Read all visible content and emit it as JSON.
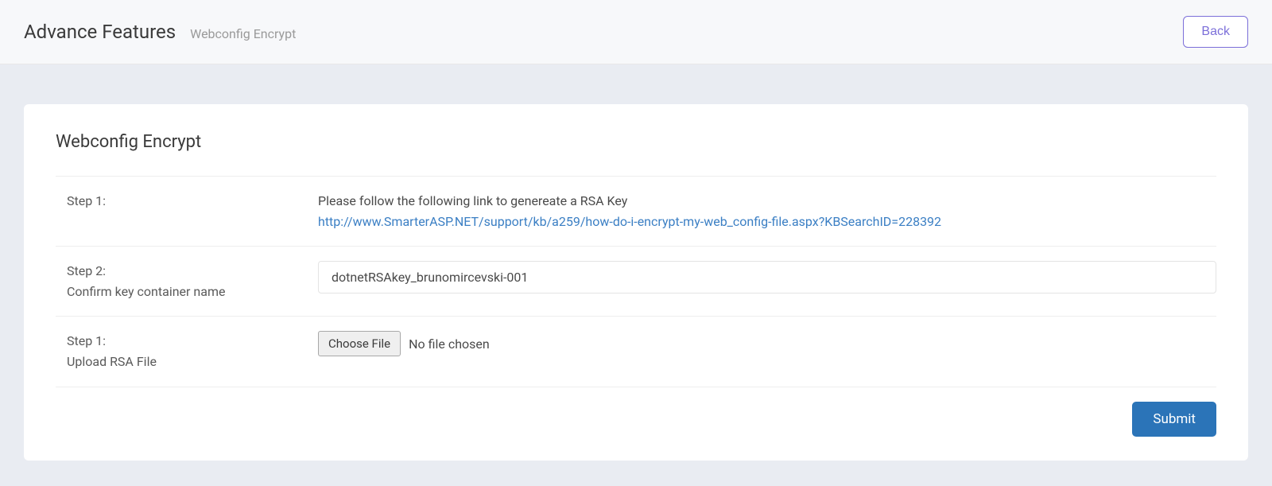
{
  "header": {
    "title": "Advance Features",
    "subtitle": "Webconfig Encrypt",
    "back_label": "Back"
  },
  "card": {
    "title": "Webconfig Encrypt"
  },
  "step1": {
    "label": "Step 1:",
    "text": "Please follow the following link to genereate a RSA Key",
    "link": "http://www.SmarterASP.NET/support/kb/a259/how-do-i-encrypt-my-web_config-file.aspx?KBSearchID=228392"
  },
  "step2": {
    "label_line1": "Step 2:",
    "label_line2": "Confirm key container name",
    "value": "dotnetRSAkey_brunomircevski-001"
  },
  "step3": {
    "label_line1": "Step 1:",
    "label_line2": "Upload RSA File",
    "choose_label": "Choose File",
    "file_status": "No file chosen"
  },
  "footer": {
    "submit_label": "Submit"
  }
}
